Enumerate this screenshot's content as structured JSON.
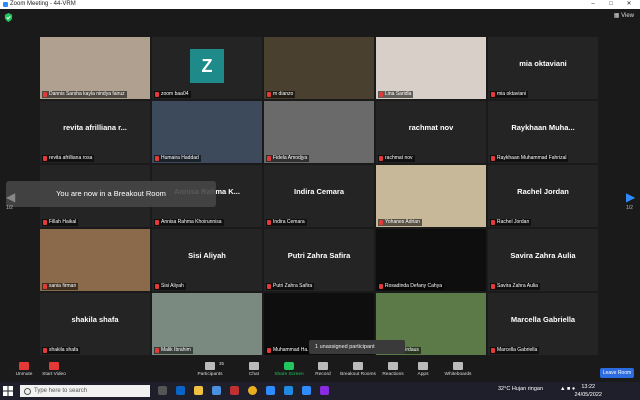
{
  "window": {
    "title": "Zoom Meeting - 44-VRM"
  },
  "topbar": {
    "view_label": "View"
  },
  "tiles": [
    {
      "label": "Dannis Sarsha kayla nindya fairuz",
      "center": "",
      "kind": "photo",
      "bg": "#b0a090"
    },
    {
      "label": "zoom baa04",
      "center": "",
      "kind": "avatar",
      "avatar_letter": "Z"
    },
    {
      "label": "m dianzo",
      "center": "",
      "kind": "photo",
      "bg": "#4a4030",
      "active": true
    },
    {
      "label": "Lina Saridla",
      "center": "",
      "kind": "photo",
      "bg": "#d8d0c8"
    },
    {
      "label": "mia oktaviani",
      "center": "mia oktaviani",
      "kind": "name"
    },
    {
      "label": "revita afrilliana rosa",
      "center": "revita afrilliana r...",
      "kind": "name"
    },
    {
      "label": "Humaira Haddad",
      "center": "",
      "kind": "photo",
      "bg": "#3c4a5c"
    },
    {
      "label": "Fidela Amodjya",
      "center": "",
      "kind": "photo",
      "bg": "#6a6a6a"
    },
    {
      "label": "rachmat nov",
      "center": "rachmat nov",
      "kind": "name"
    },
    {
      "label": "Raykhaan Muhammad Fahrizal",
      "center": "Raykhaan Muha...",
      "kind": "name"
    },
    {
      "label": "Fillah Haikal",
      "center": "",
      "kind": "name"
    },
    {
      "label": "Annisa Rahma Khoirunnisa",
      "center": "Annisa Rahma K...",
      "kind": "name"
    },
    {
      "label": "Indira Cemara",
      "center": "Indira Cemara",
      "kind": "name"
    },
    {
      "label": "Yohanes Adrian",
      "center": "",
      "kind": "photo",
      "bg": "#c8b89a"
    },
    {
      "label": "Rachel Jordan",
      "center": "Rachel Jordan",
      "kind": "name"
    },
    {
      "label": "sania firman",
      "center": "",
      "kind": "photo",
      "bg": "#8a6a4a"
    },
    {
      "label": "Sisi Aliyah",
      "center": "Sisi Aliyah",
      "kind": "name"
    },
    {
      "label": "Putri Zahra Safira",
      "center": "Putri Zahra Safira",
      "kind": "name"
    },
    {
      "label": "Rosadinda Defany Cahya",
      "center": "",
      "kind": "photo",
      "bg": "#0e0e0e"
    },
    {
      "label": "Savira Zahra Aulia",
      "center": "Savira Zahra Aulia",
      "kind": "name"
    },
    {
      "label": "shakila shafa",
      "center": "shakila shafa",
      "kind": "name"
    },
    {
      "label": "Malik Ibrahim",
      "center": "",
      "kind": "photo",
      "bg": "#7a8a80"
    },
    {
      "label": "Muhammad Ha...",
      "center": "",
      "kind": "photo",
      "bg": "#0e0e0e"
    },
    {
      "label": "Ahmad Firdaus",
      "center": "",
      "kind": "photo",
      "bg": "#5c7a48"
    },
    {
      "label": "Marcella Gabriella",
      "center": "Marcella Gabriella",
      "kind": "name"
    }
  ],
  "breakout_banner": "You are now in a Breakout Room",
  "unassigned_label": "1 unassigned participant",
  "page_indicator_left": "1/2",
  "page_indicator_right": "1/2",
  "controls": [
    {
      "label": "Unmute"
    },
    {
      "label": "Start Video"
    },
    {
      "label": "Participants",
      "badge": "35"
    },
    {
      "label": "Chat"
    },
    {
      "label": "Share Screen"
    },
    {
      "label": "Record"
    },
    {
      "label": "Breakout Rooms"
    },
    {
      "label": "Reactions"
    },
    {
      "label": "Apps"
    },
    {
      "label": "Whiteboards"
    }
  ],
  "leave_label": "Leave Room",
  "taskbar": {
    "search_placeholder": "Type here to search",
    "weather": "32°C  Hujan ringan",
    "time": "13:22",
    "date": "24/05/2022"
  },
  "colors": {
    "accent": "#2d8cff",
    "share": "#22c55e",
    "active_border": "#c8e83c",
    "mic_muted": "#e53935"
  }
}
